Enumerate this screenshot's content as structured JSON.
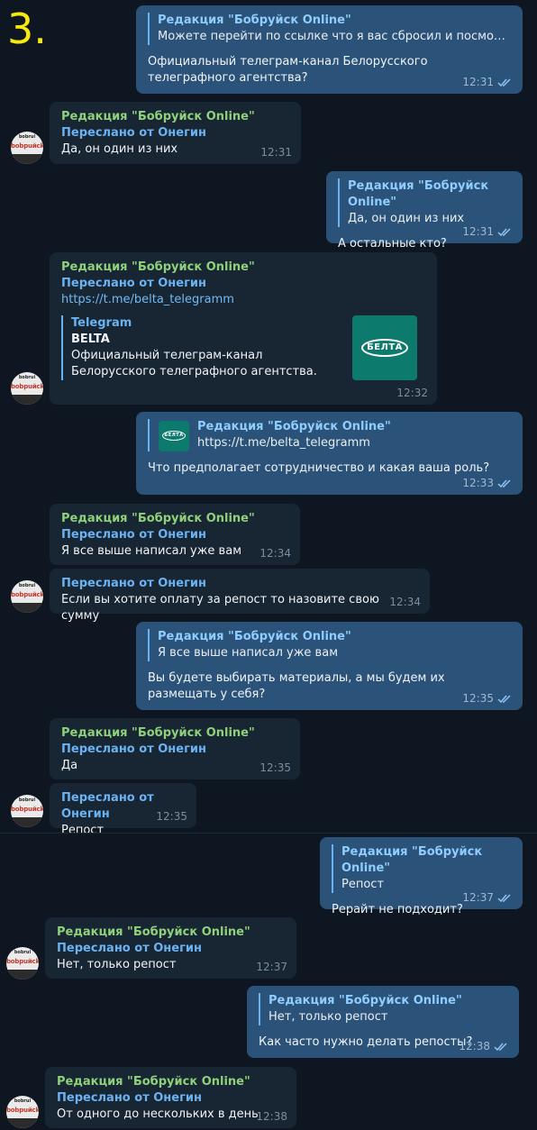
{
  "page_number": "3.",
  "colors": {
    "background": "#0e1621",
    "incoming": "#182533",
    "outgoing": "#2b5278",
    "sender": "#8ed17a",
    "forward": "#6ab3f3",
    "number": "#f5e90e"
  },
  "avatar": {
    "top": "bobrui",
    "name": "bobрuйсk"
  },
  "messages": {
    "m1": {
      "reply_name": "Редакция \"Бобруйск Online\"",
      "reply_text": "Можете перейти по ссылке что я вас сбросил и посмотреть с ...",
      "text": "Официальный телеграм-канал Белорусского телеграфного агентства?",
      "time": "12:31"
    },
    "m2": {
      "sender": "Редакция \"Бобруйск Online\"",
      "forward": "Переслано от Онегин",
      "text": "Да, он один из них",
      "time": "12:31"
    },
    "m3": {
      "reply_name": "Редакция \"Бобруйск Online\"",
      "reply_text": "Да, он один из них",
      "text": "А остальные кто?",
      "time": "12:31"
    },
    "m4": {
      "sender": "Редакция \"Бобруйск Online\"",
      "forward": "Переслано от Онегин",
      "link": "https://t.me/belta_telegramm",
      "preview_site": "Telegram",
      "preview_title": "BELTA",
      "preview_desc": "Официальный телеграм-канал Белорусского телеграфного агентства.",
      "thumb_text": "БЕЛТА",
      "time": "12:32"
    },
    "m5": {
      "reply_name": "Редакция \"Бобруйск Online\"",
      "reply_text": "https://t.me/belta_telegramm",
      "thumb_text": "БЕЛТА",
      "text": "Что предполагает сотрудничество и какая ваша роль?",
      "time": "12:33"
    },
    "m6": {
      "sender": "Редакция \"Бобруйск Online\"",
      "forward": "Переслано от Онегин",
      "text": "Я все выше написал уже вам",
      "time": "12:34"
    },
    "m7": {
      "forward": "Переслано от Онегин",
      "text": "Если вы хотите оплату за репост то назовите свою сумму",
      "time": "12:34"
    },
    "m8": {
      "reply_name": "Редакция \"Бобруйск Online\"",
      "reply_text": "Я все выше написал уже вам",
      "text": "Вы будете выбирать материалы, а мы будем их размещать у себя?",
      "time": "12:35"
    },
    "m9": {
      "sender": "Редакция \"Бобруйск Online\"",
      "forward": "Переслано от Онегин",
      "text": "Да",
      "time": "12:35"
    },
    "m10": {
      "forward": "Переслано от Онегин",
      "text": "Репост",
      "time": "12:35"
    },
    "m11": {
      "reply_name": "Редакция \"Бобруйск Online\"",
      "reply_text": "Репост",
      "text": "Рерайт не подходит?",
      "time": "12:37"
    },
    "m12": {
      "sender": "Редакция \"Бобруйск Online\"",
      "forward": "Переслано от Онегин",
      "text": "Нет,  только репост",
      "time": "12:37"
    },
    "m13": {
      "reply_name": "Редакция \"Бобруйск Online\"",
      "reply_text": "Нет,  только репост",
      "text": "Как часто нужно делать репосты?",
      "time": "12:38"
    },
    "m14": {
      "sender": "Редакция \"Бобруйск Online\"",
      "forward": "Переслано от Онегин",
      "text": "От одного до нескольких в день",
      "time": "12:38"
    }
  }
}
